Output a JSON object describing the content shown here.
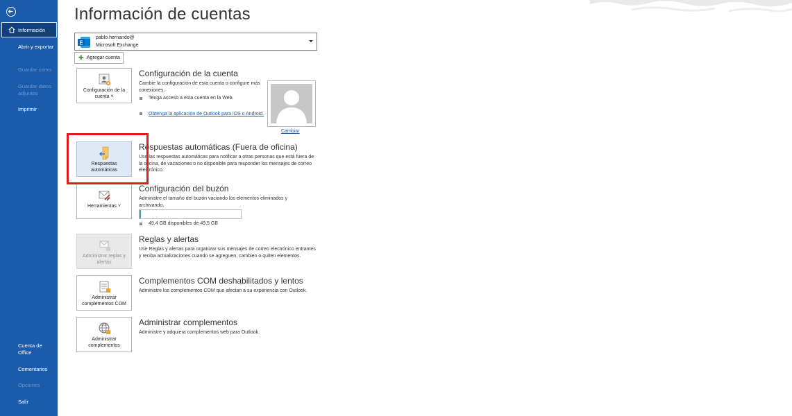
{
  "sidebar": {
    "active_item": "Información",
    "items": {
      "abrir": "Abrir y exportar",
      "guardar_como": "Guardar como",
      "guardar_datos": "Guardar datos adjuntos",
      "imprimir": "Imprimir",
      "cuenta_office": "Cuenta de Office",
      "comentarios": "Comentarios",
      "opciones": "Opciones",
      "salir": "Salir"
    }
  },
  "page": {
    "title": "Información de cuentas"
  },
  "account": {
    "email": "pablo.hernando@",
    "type": "Microsoft Exchange",
    "add_label": "Agregar cuenta"
  },
  "sections": {
    "config": {
      "tile_label": "Configuración de la cuenta ˅",
      "title": "Configuración de la cuenta",
      "desc": "Cambie la configuración de esta cuenta o configure más conexiones.",
      "bullet1": "Tenga acceso a esta cuenta en la Web.",
      "bullet2": "Obtenga la aplicación de Outlook para iOS o Android.",
      "change_label": "Cambiar"
    },
    "auto_reply": {
      "tile_label": "Respuestas automáticas",
      "title": "Respuestas automáticas (Fuera de oficina)",
      "desc": "Use las respuestas automáticas para notificar a otras personas que está fuera de la oficina, de vacaciones o no disponible para responder los mensajes de correo electrónico."
    },
    "mailbox": {
      "tile_label": "Herramientas ˅",
      "title": "Configuración del buzón",
      "desc": "Administre el tamaño del buzón vaciando los elementos eliminados y archivando.",
      "storage_text": "49,4 GB disponibles de 49,5 GB",
      "used_fraction": 0.01
    },
    "rules": {
      "tile_label": "Administrar reglas y alertas",
      "title": "Reglas y alertas",
      "desc": "Use Reglas y alertas para organizar sus mensajes de correo electrónico entrantes y reciba actualizaciones cuando se agreguen, cambien o quiten elementos."
    },
    "com": {
      "tile_label": "Administrar complementos COM",
      "title": "Complementos COM deshabilitados y lentos",
      "desc": "Administre los complementos COM que afectan a su experiencia con Outlook."
    },
    "addins": {
      "tile_label": "Administrar complementos",
      "title": "Administrar complementos",
      "desc": "Administre y adquiera complementos web para Outlook."
    }
  },
  "colors": {
    "sidebar_bg": "#1b5bab",
    "active_bg": "#12407d",
    "highlight": "#e01b1b",
    "progress_fill": "#4aa3b3",
    "link": "#1c5aa6"
  }
}
